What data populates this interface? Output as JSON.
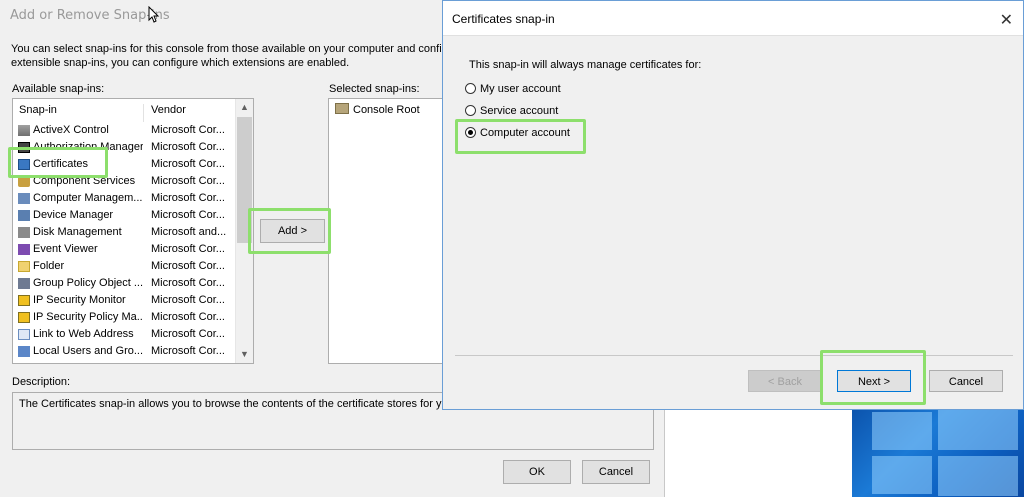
{
  "left_dialog": {
    "title": "Add or Remove Snap-ins",
    "intro_line1": "You can select snap-ins for this console from those available on your computer and confi",
    "intro_line2": "extensible snap-ins, you can configure which extensions are enabled.",
    "available_label": "Available snap-ins:",
    "selected_label": "Selected snap-ins:",
    "columns": {
      "snapin": "Snap-in",
      "vendor": "Vendor"
    },
    "snapins": [
      {
        "name": "ActiveX Control",
        "vendor": "Microsoft Cor...",
        "icon": "activex-icon"
      },
      {
        "name": "Authorization Manager",
        "vendor": "Microsoft Cor...",
        "icon": "authorization-icon"
      },
      {
        "name": "Certificates",
        "vendor": "Microsoft Cor...",
        "icon": "certificate-icon"
      },
      {
        "name": "Component Services",
        "vendor": "Microsoft Cor...",
        "icon": "component-services-icon"
      },
      {
        "name": "Computer Managem...",
        "vendor": "Microsoft Cor...",
        "icon": "computer-management-icon"
      },
      {
        "name": "Device Manager",
        "vendor": "Microsoft Cor...",
        "icon": "device-manager-icon"
      },
      {
        "name": "Disk Management",
        "vendor": "Microsoft and...",
        "icon": "disk-icon"
      },
      {
        "name": "Event Viewer",
        "vendor": "Microsoft Cor...",
        "icon": "event-viewer-icon"
      },
      {
        "name": "Folder",
        "vendor": "Microsoft Cor...",
        "icon": "folder-icon"
      },
      {
        "name": "Group Policy Object ...",
        "vendor": "Microsoft Cor...",
        "icon": "group-policy-icon"
      },
      {
        "name": "IP Security Monitor",
        "vendor": "Microsoft Cor...",
        "icon": "ip-security-icon"
      },
      {
        "name": "IP Security Policy Ma...",
        "vendor": "Microsoft Cor...",
        "icon": "ip-security-policy-icon"
      },
      {
        "name": "Link to Web Address",
        "vendor": "Microsoft Cor...",
        "icon": "link-icon"
      },
      {
        "name": "Local Users and Gro...",
        "vendor": "Microsoft Cor...",
        "icon": "local-users-icon"
      }
    ],
    "add_button": "Add >",
    "selected_items": [
      {
        "name": "Console Root",
        "icon": "folder-icon"
      }
    ],
    "description_label": "Description:",
    "description_text": "The Certificates snap-in allows you to browse the contents of the certificate stores for yourself, a service, or a computer.",
    "ok_button": "OK",
    "cancel_button": "Cancel"
  },
  "right_dialog": {
    "title": "Certificates snap-in",
    "prompt": "This snap-in will always manage certificates for:",
    "options": [
      {
        "label": "My user account",
        "selected": false
      },
      {
        "label": "Service account",
        "selected": false
      },
      {
        "label": "Computer account",
        "selected": true
      }
    ],
    "back_button": "< Back",
    "next_button": "Next >",
    "cancel_button": "Cancel"
  },
  "colors": {
    "highlight": "#8ddf6c",
    "accent": "#0078d7"
  }
}
